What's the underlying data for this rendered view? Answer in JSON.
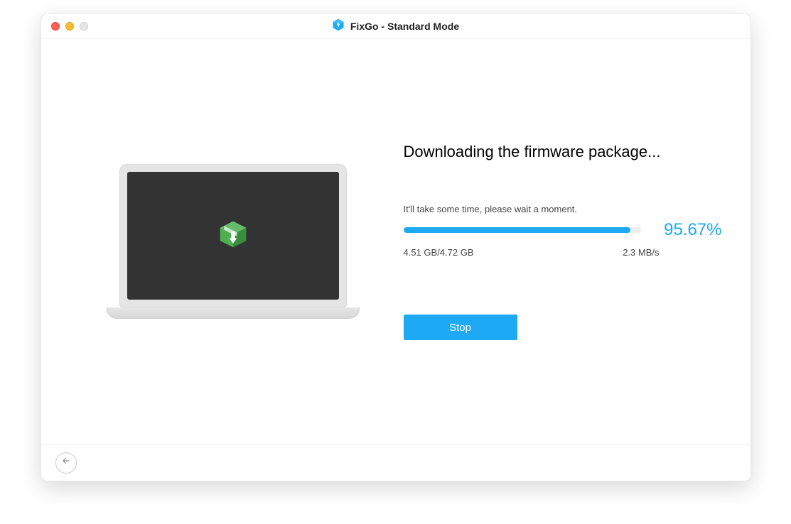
{
  "window": {
    "title": "FixGo - Standard Mode"
  },
  "download": {
    "heading": "Downloading the firmware package...",
    "wait_text": "It'll take some time, please wait a moment.",
    "progress_percent_label": "95.67%",
    "progress_fraction": 0.9567,
    "downloaded_label": "4.51 GB/4.72 GB",
    "speed_label": "2.3 MB/s",
    "stop_label": "Stop"
  },
  "colors": {
    "accent": "#1da9f4"
  }
}
